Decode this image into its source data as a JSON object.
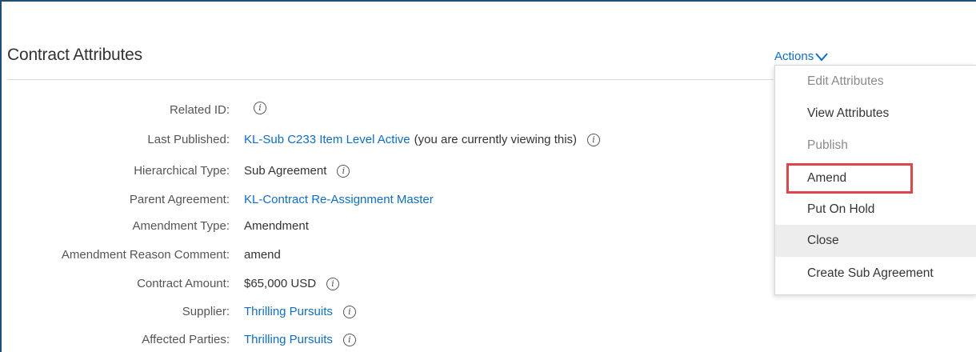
{
  "section_title": "Contract Attributes",
  "actions_label": "Actions",
  "menu": {
    "items": [
      {
        "label": "Edit Attributes",
        "disabled": true
      },
      {
        "label": "View Attributes",
        "disabled": false
      },
      {
        "label": "Publish",
        "disabled": true
      },
      {
        "label": "Amend",
        "disabled": false,
        "highlighted": true
      },
      {
        "label": "Put On Hold",
        "disabled": false
      },
      {
        "label": "Close",
        "disabled": false,
        "hovered": true
      },
      {
        "label": "Create Sub Agreement",
        "disabled": false
      }
    ]
  },
  "attributes": {
    "related_id": {
      "label": "Related ID:",
      "value": ""
    },
    "last_published": {
      "label": "Last Published:",
      "link": "KL-Sub C233 Item Level Active",
      "suffix": "(you are currently viewing this)"
    },
    "hierarchical_type": {
      "label": "Hierarchical Type:",
      "value": "Sub Agreement"
    },
    "parent_agreement": {
      "label": "Parent Agreement:",
      "link": "KL-Contract Re-Assignment Master"
    },
    "amendment_type": {
      "label": "Amendment Type:",
      "value": "Amendment"
    },
    "amendment_reason_comment": {
      "label": "Amendment Reason Comment:",
      "value": "amend"
    },
    "contract_amount": {
      "label": "Contract Amount:",
      "value": "$65,000 USD"
    },
    "supplier": {
      "label": "Supplier:",
      "link": "Thrilling Pursuits"
    },
    "affected_parties": {
      "label": "Affected Parties:",
      "link": "Thrilling Pursuits"
    }
  },
  "info_icon_glyph": "i",
  "colors": {
    "link": "#0a6ed1",
    "highlight_border": "#e0454a",
    "frame": "#1f4e79"
  }
}
